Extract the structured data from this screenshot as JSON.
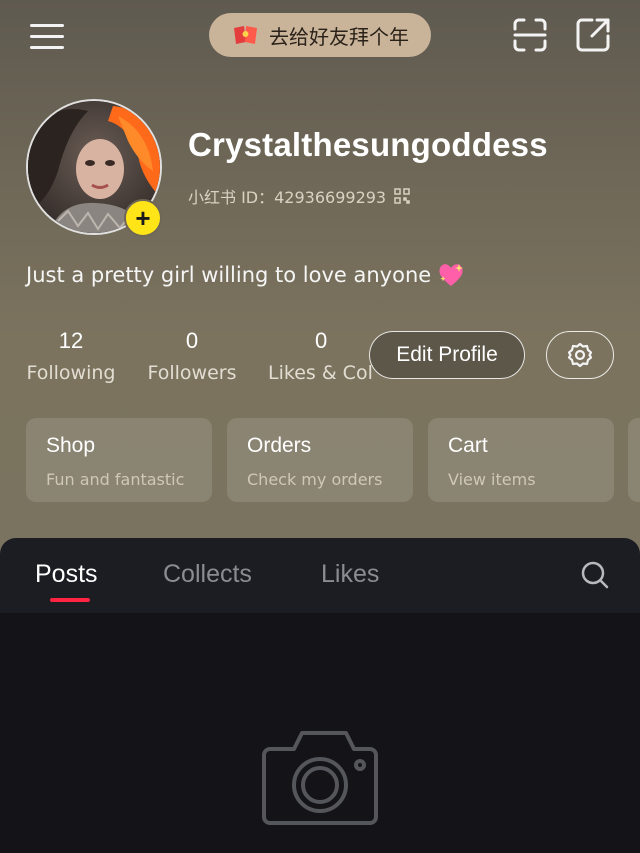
{
  "topbar": {
    "menu_icon": "menu-icon",
    "promo_label": "去给好友拜个年",
    "promo_icon": "red-envelope-icon",
    "scan_icon": "scan-icon",
    "share_icon": "share-icon",
    "promo_color": "#c9b49a"
  },
  "profile": {
    "username": "Crystalthesungoddess",
    "id_label": "小红书 ID：42936699293",
    "bio": "Just a pretty girl willing to love anyone",
    "avatar_badge": "+",
    "badge_color": "#ffe418"
  },
  "stats": [
    {
      "value": "12",
      "label": "Following"
    },
    {
      "value": "0",
      "label": "Followers"
    },
    {
      "value": "0",
      "label": "Likes & Col"
    }
  ],
  "actions": {
    "edit_profile": "Edit Profile",
    "settings_icon": "gear-icon"
  },
  "cards": [
    {
      "title": "Shop",
      "subtitle": "Fun and fantastic"
    },
    {
      "title": "Orders",
      "subtitle": "Check my orders"
    },
    {
      "title": "Cart",
      "subtitle": "View items"
    }
  ],
  "tabs": {
    "items": [
      {
        "label": "Posts",
        "active": true
      },
      {
        "label": "Collects",
        "active": false
      },
      {
        "label": "Likes",
        "active": false
      }
    ],
    "accent_color": "#ff2442"
  },
  "empty_state": {
    "icon": "camera-icon"
  }
}
